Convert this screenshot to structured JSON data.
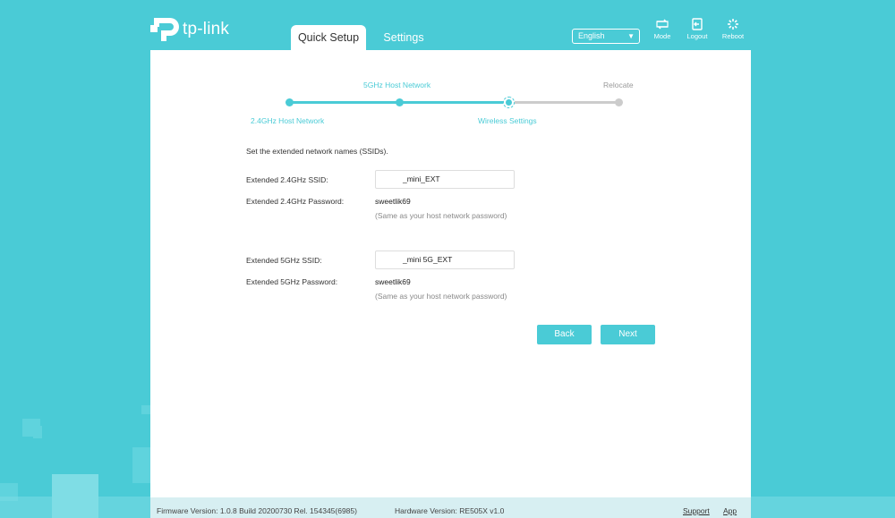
{
  "header": {
    "brand": "tp-link",
    "tabs": [
      {
        "label": "Quick Setup",
        "active": true
      },
      {
        "label": "Settings",
        "active": false
      }
    ],
    "language": "English",
    "actions": [
      {
        "label": "Mode",
        "icon": "mode-icon"
      },
      {
        "label": "Logout",
        "icon": "logout-icon"
      },
      {
        "label": "Reboot",
        "icon": "reboot-icon"
      }
    ]
  },
  "progress": {
    "steps": [
      "2.4GHz Host Network",
      "5GHz Host Network",
      "Wireless Settings",
      "Relocate"
    ],
    "current_step": 3
  },
  "form": {
    "intro": "Set the extended network names (SSIDs).",
    "ssid24_label": "Extended 2.4GHz SSID:",
    "ssid24_value": "_mini_EXT",
    "pwd24_label": "Extended 2.4GHz Password:",
    "pwd24_value": "sweetlik69",
    "pwd24_note": "(Same as your host network password)",
    "ssid5_label": "Extended 5GHz SSID:",
    "ssid5_value": "_mini 5G_EXT",
    "pwd5_label": "Extended 5GHz Password:",
    "pwd5_value": "sweetlik69",
    "pwd5_note": "(Same as your host network password)"
  },
  "buttons": {
    "back": "Back",
    "next": "Next"
  },
  "footer": {
    "firmware": "Firmware Version: 1.0.8 Build 20200730 Rel. 154345(6985)",
    "hardware": "Hardware Version: RE505X v1.0",
    "support": "Support",
    "app": "App"
  },
  "colors": {
    "accent": "#4acbd6",
    "inactive_step": "#cccccc"
  }
}
